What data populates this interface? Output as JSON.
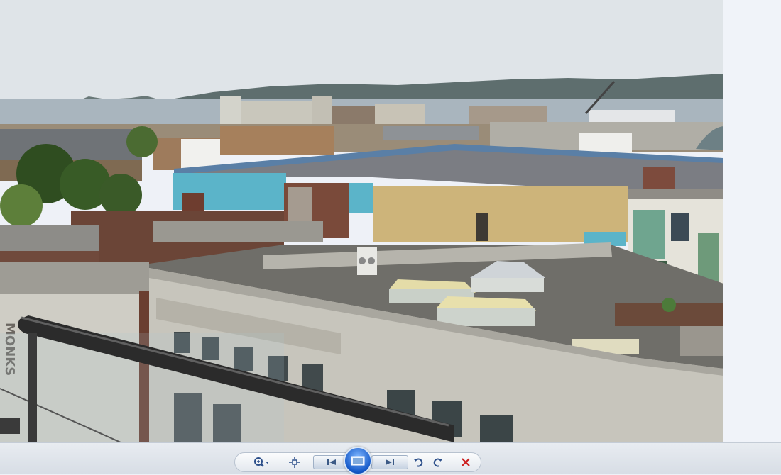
{
  "window": {
    "title": ""
  },
  "photo": {
    "description_icon": "photo",
    "storefront_sign": "MONKS"
  },
  "colors": {
    "sky": "#dde3e8",
    "sea": "#a6b3bd",
    "toolbar": "#dde2e9",
    "slideshow_blue": "#1559c8",
    "delete_red": "#cc1f1f"
  },
  "toolbar": {
    "zoom": {
      "icon": "magnifier-icon"
    },
    "actual_size": {
      "icon": "fit-window-icon"
    },
    "previous": {
      "icon": "previous-icon"
    },
    "slideshow": {
      "icon": "slideshow-icon"
    },
    "next": {
      "icon": "next-icon"
    },
    "rotate_ccw": {
      "icon": "rotate-counterclockwise-icon"
    },
    "rotate_cw": {
      "icon": "rotate-clockwise-icon"
    },
    "delete": {
      "icon": "delete-icon"
    }
  }
}
